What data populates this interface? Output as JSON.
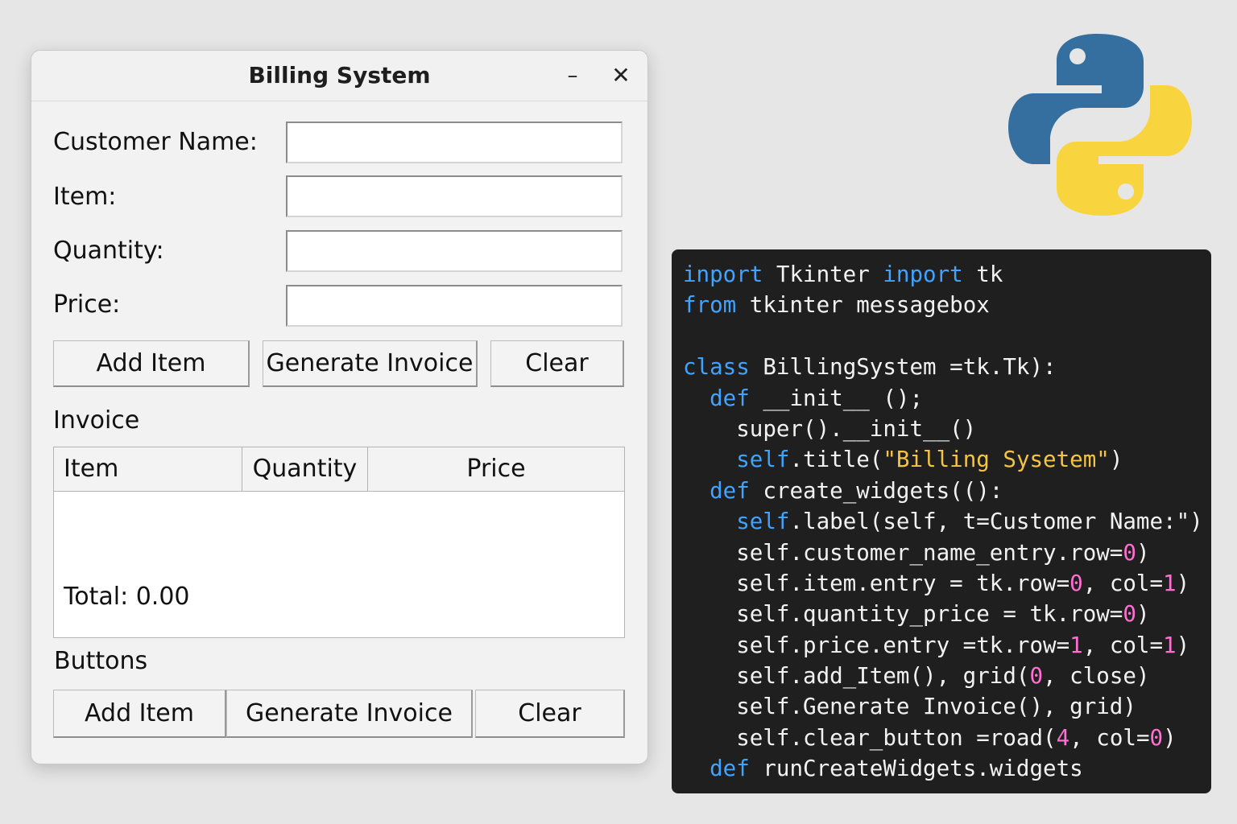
{
  "window": {
    "title": "Billing System",
    "minimize_glyph": "–",
    "close_glyph": "✕"
  },
  "form": {
    "customer_name_label": "Customer Name:",
    "item_label": "Item:",
    "quantity_label": "Quantity:",
    "price_label": "Price:",
    "customer_name_value": "",
    "item_value": "",
    "quantity_value": "",
    "price_value": ""
  },
  "top_buttons": {
    "add_item": "Add Item",
    "generate_invoice": "Generate Invoice",
    "clear": "Clear"
  },
  "invoice": {
    "section_label": "Invoice",
    "columns": [
      "Item",
      "Quantity",
      "Price"
    ],
    "total_text": "Total: 0.00"
  },
  "bottom_section": {
    "label": "Buttons",
    "add_item": "Add Item",
    "generate_invoice": "Generate Invoice",
    "clear": "Clear"
  },
  "logo": {
    "icon": "python-logo",
    "colors": {
      "blue": "#346fa0",
      "yellow": "#f8d53f"
    }
  },
  "code": {
    "colors": {
      "background": "#1f1f1f",
      "keyword": "#3fa3ff",
      "string": "#f5c542",
      "number": "#ff6fd1",
      "text": "#f2f2f2"
    },
    "lines": [
      [
        {
          "t": "kw",
          "s": "inport"
        },
        {
          "t": "plain",
          "s": " Tkinter "
        },
        {
          "t": "kw",
          "s": "inport"
        },
        {
          "t": "plain",
          "s": " tk"
        }
      ],
      [
        {
          "t": "kw",
          "s": "from"
        },
        {
          "t": "plain",
          "s": " tkinter messagebox"
        }
      ],
      [],
      [
        {
          "t": "kw",
          "s": "class"
        },
        {
          "t": "plain",
          "s": " BillingSystem =tk.Tk):"
        }
      ],
      [
        {
          "t": "plain",
          "s": "  "
        },
        {
          "t": "kw",
          "s": "def"
        },
        {
          "t": "plain",
          "s": " __init__ ();"
        }
      ],
      [
        {
          "t": "plain",
          "s": "    super().__init__()"
        }
      ],
      [
        {
          "t": "plain",
          "s": "    "
        },
        {
          "t": "kw",
          "s": "self"
        },
        {
          "t": "plain",
          "s": ".title("
        },
        {
          "t": "str",
          "s": "\"Billing Sysetem\""
        },
        {
          "t": "plain",
          "s": ")"
        }
      ],
      [
        {
          "t": "plain",
          "s": "  "
        },
        {
          "t": "kw",
          "s": "def"
        },
        {
          "t": "plain",
          "s": " create_widgets(():"
        }
      ],
      [
        {
          "t": "plain",
          "s": "    "
        },
        {
          "t": "kw",
          "s": "self"
        },
        {
          "t": "plain",
          "s": ".label(self, t=Customer Name:\")"
        }
      ],
      [
        {
          "t": "plain",
          "s": "    self.customer_name_entry.row="
        },
        {
          "t": "num",
          "s": "0"
        },
        {
          "t": "plain",
          "s": ")"
        }
      ],
      [
        {
          "t": "plain",
          "s": "    self.item.entry = tk.row="
        },
        {
          "t": "num",
          "s": "0"
        },
        {
          "t": "plain",
          "s": ", col="
        },
        {
          "t": "num",
          "s": "1"
        },
        {
          "t": "plain",
          "s": ")"
        }
      ],
      [
        {
          "t": "plain",
          "s": "    self.quantity_price = tk.row="
        },
        {
          "t": "num",
          "s": "0"
        },
        {
          "t": "plain",
          "s": ")"
        }
      ],
      [
        {
          "t": "plain",
          "s": "    self.price.entry =tk.row="
        },
        {
          "t": "num",
          "s": "1"
        },
        {
          "t": "plain",
          "s": ", col="
        },
        {
          "t": "num",
          "s": "1"
        },
        {
          "t": "plain",
          "s": ")"
        }
      ],
      [
        {
          "t": "plain",
          "s": "    self.add_Item(), grid("
        },
        {
          "t": "num",
          "s": "0"
        },
        {
          "t": "plain",
          "s": ", close)"
        }
      ],
      [
        {
          "t": "plain",
          "s": "    self.Generate Invoice(), grid)"
        }
      ],
      [
        {
          "t": "plain",
          "s": "    self.clear_button =road("
        },
        {
          "t": "num",
          "s": "4"
        },
        {
          "t": "plain",
          "s": ", col="
        },
        {
          "t": "num",
          "s": "0"
        },
        {
          "t": "plain",
          "s": ")"
        }
      ],
      [
        {
          "t": "plain",
          "s": "  "
        },
        {
          "t": "kw",
          "s": "def"
        },
        {
          "t": "plain",
          "s": " runCreateWidgets.widgets"
        }
      ]
    ]
  }
}
